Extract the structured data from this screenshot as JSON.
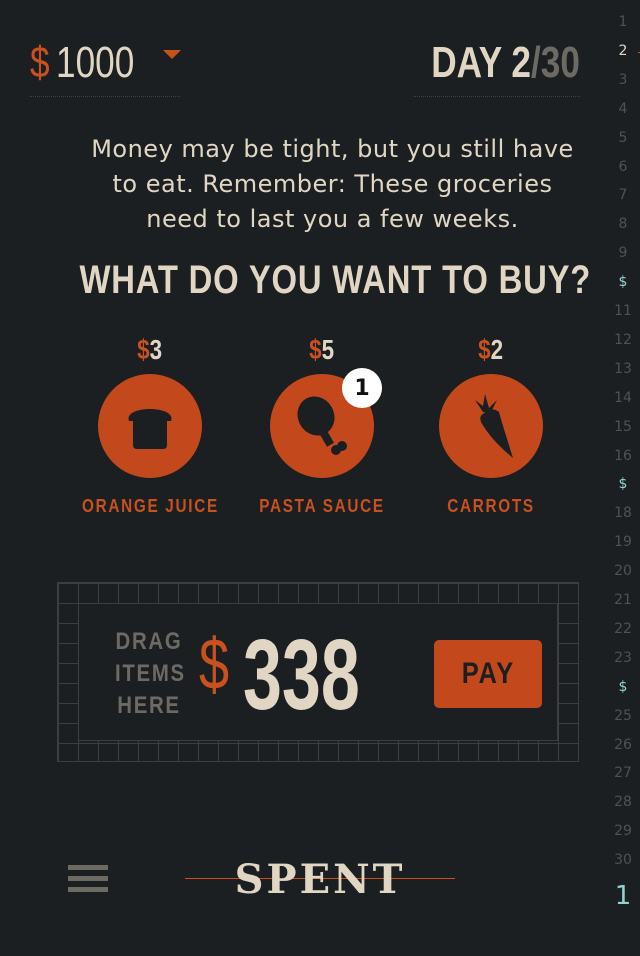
{
  "header": {
    "money_symbol": "$",
    "money_amount": "1000",
    "day_label": "DAY 2",
    "day_sep": "/",
    "day_total": "30"
  },
  "intro_text": "Money may be tight, but you still have to eat. Remember: These groceries need to last you a few weeks.",
  "question": "WHAT DO YOU WANT TO BUY?",
  "items": [
    {
      "price_symbol": "$",
      "price": "3",
      "label": "ORANGE JUICE",
      "icon": "bread-icon"
    },
    {
      "price_symbol": "$",
      "price": "5",
      "label": "PASTA SAUCE",
      "icon": "drumstick-icon",
      "badge": "1"
    },
    {
      "price_symbol": "$",
      "price": "2",
      "label": "CARROTS",
      "icon": "carrot-icon"
    }
  ],
  "cart": {
    "drag_line1": "DRAG",
    "drag_line2": "ITEMS",
    "drag_line3": "HERE",
    "total_symbol": "$",
    "total": "338",
    "pay_label": "PAY"
  },
  "footer": {
    "logo": "SPENT",
    "menu_icon": "hamburger-icon"
  },
  "ruler": {
    "labels": [
      "1",
      "2",
      "3",
      "4",
      "5",
      "6",
      "7",
      "8",
      "9",
      "$",
      "11",
      "12",
      "13",
      "14",
      "15",
      "16",
      "$",
      "18",
      "19",
      "20",
      "21",
      "22",
      "23",
      "$",
      "25",
      "26",
      "27",
      "28",
      "29",
      "30"
    ],
    "current": "2",
    "bottom": "1"
  },
  "colors": {
    "background": "#1b1f22",
    "accent": "#c3491c",
    "text": "#e0d6c3",
    "muted": "#6d6a64",
    "ruler_highlight": "#8fd4cf"
  }
}
